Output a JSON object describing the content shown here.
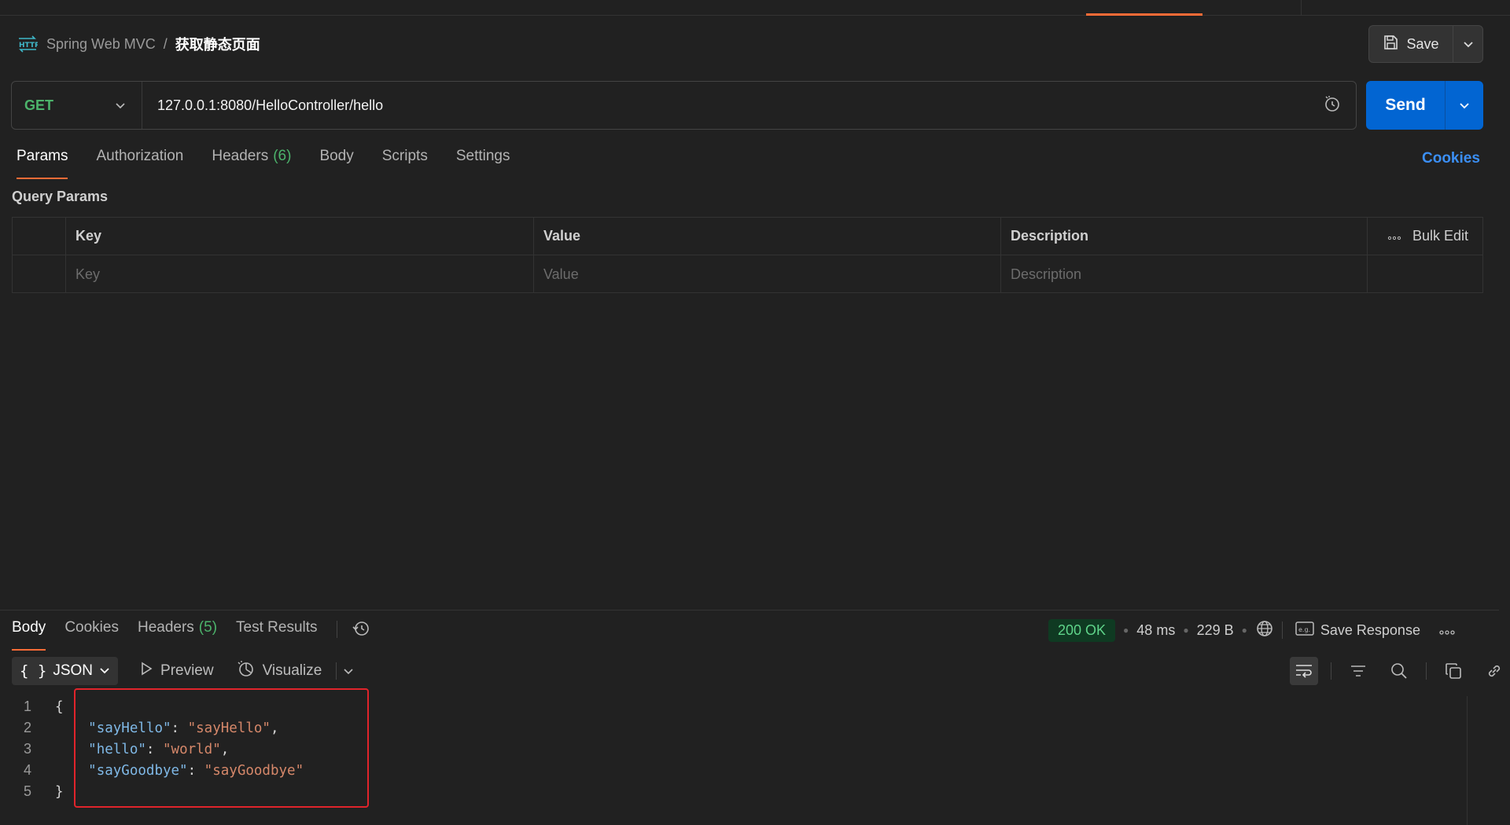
{
  "breadcrumb": {
    "collection": "Spring Web MVC",
    "separator": "/",
    "request_name": "获取静态页面",
    "icon": "http-icon"
  },
  "save": {
    "label": "Save"
  },
  "request": {
    "method": "GET",
    "url": "127.0.0.1:8080/HelloController/hello",
    "send_label": "Send"
  },
  "request_tabs": [
    {
      "label": "Params",
      "active": true
    },
    {
      "label": "Authorization"
    },
    {
      "label": "Headers",
      "count": "(6)"
    },
    {
      "label": "Body"
    },
    {
      "label": "Scripts"
    },
    {
      "label": "Settings"
    }
  ],
  "cookies_link": "Cookies",
  "query_params": {
    "title": "Query Params",
    "columns": [
      "Key",
      "Value",
      "Description"
    ],
    "bulk_edit": "Bulk Edit",
    "placeholders": [
      "Key",
      "Value",
      "Description"
    ]
  },
  "response_tabs": [
    {
      "label": "Body",
      "active": true
    },
    {
      "label": "Cookies"
    },
    {
      "label": "Headers",
      "count": "(5)"
    },
    {
      "label": "Test Results"
    }
  ],
  "response_status": {
    "status": "200 OK",
    "time": "48 ms",
    "size": "229 B",
    "save_response": "Save Response"
  },
  "format_bar": {
    "format": "JSON",
    "preview": "Preview",
    "visualize": "Visualize"
  },
  "code_lines": [
    {
      "n": "1",
      "parts": [
        [
          "p",
          "{"
        ]
      ]
    },
    {
      "n": "2",
      "parts": [
        [
          "p",
          "    "
        ],
        [
          "k",
          "\"sayHello\""
        ],
        [
          "p",
          ": "
        ],
        [
          "s",
          "\"sayHello\""
        ],
        [
          "p",
          ","
        ]
      ]
    },
    {
      "n": "3",
      "parts": [
        [
          "p",
          "    "
        ],
        [
          "k",
          "\"hello\""
        ],
        [
          "p",
          ": "
        ],
        [
          "s",
          "\"world\""
        ],
        [
          "p",
          ","
        ]
      ]
    },
    {
      "n": "4",
      "parts": [
        [
          "p",
          "    "
        ],
        [
          "k",
          "\"sayGoodbye\""
        ],
        [
          "p",
          ": "
        ],
        [
          "s",
          "\"sayGoodbye\""
        ]
      ]
    },
    {
      "n": "5",
      "parts": [
        [
          "p",
          "}"
        ]
      ]
    }
  ],
  "colors": {
    "accent": "#ff6c37",
    "send": "#0265d2",
    "method_get": "#4cb36b",
    "highlight": "#e0242b"
  }
}
